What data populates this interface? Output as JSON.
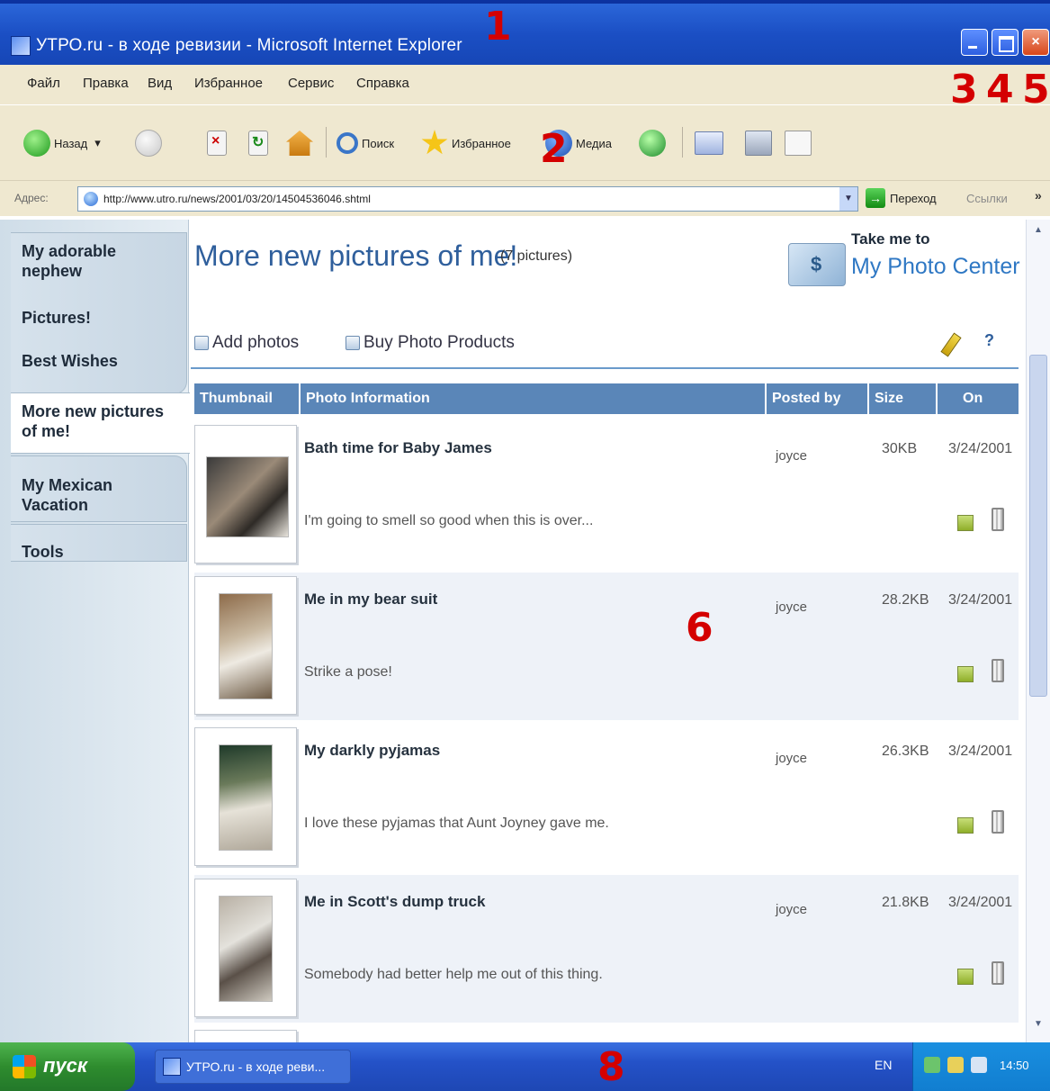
{
  "window": {
    "title": "УТРО.ru - в ходе ревизии - Microsoft Internet Explorer",
    "annotations": [
      "1",
      "2",
      "3",
      "4",
      "5",
      "6",
      "8"
    ]
  },
  "menu": [
    "Файл",
    "Правка",
    "Вид",
    "Избранное",
    "Сервис",
    "Справка"
  ],
  "toolbar": {
    "back_label": "Назад",
    "back_arrow": "▾",
    "search_label": "Поиск",
    "favorites_label": "Избранное",
    "media_label": "Медиа"
  },
  "address": {
    "label": "Адрес:",
    "url": "http://www.utro.ru/news/2001/03/20/14504536046.shtml",
    "go_label": "Переход",
    "links_label": "Ссылки",
    "links_arrow": "»"
  },
  "sidebar": {
    "items": [
      {
        "line1": "My adorable",
        "line2": "nephew"
      },
      {
        "line1": "Pictures!"
      },
      {
        "line1": "Best Wishes"
      },
      {
        "line1": "More new pictures",
        "line2": "of me!"
      },
      {
        "line1": "My Mexican",
        "line2": "Vacation"
      },
      {
        "line1": "Tools"
      }
    ]
  },
  "main": {
    "title": "More new pictures of me!",
    "count": "(7 pictures)",
    "photo_center": {
      "line1": "Take me to",
      "line2": "My Photo Center"
    },
    "actions": {
      "add": "Add photos",
      "buy": "Buy Photo Products",
      "help": "?"
    },
    "columns": [
      "Thumbnail",
      "Photo Information",
      "Posted by",
      "Size",
      "On"
    ],
    "rows": [
      {
        "title": "Bath time for Baby James",
        "desc": "I'm going to smell so good when this is over...",
        "by": "joyce",
        "size": "30KB",
        "date": "3/24/2001"
      },
      {
        "title": "Me in my bear suit",
        "desc": "Strike a pose!",
        "by": "joyce",
        "size": "28.2KB",
        "date": "3/24/2001"
      },
      {
        "title": "My darkly pyjamas",
        "desc": "I love these pyjamas that Aunt Joyney gave me.",
        "by": "joyce",
        "size": "26.3KB",
        "date": "3/24/2001"
      },
      {
        "title": "Me in Scott's dump truck",
        "desc": "Somebody had better help me out of this thing.",
        "by": "joyce",
        "size": "21.8KB",
        "date": "3/24/2001"
      }
    ]
  },
  "taskbar": {
    "start": "пуск",
    "task": "УТРО.ru - в ходе реви...",
    "lang": "EN",
    "clock": "14:50"
  },
  "colors": {
    "accent": "#2f5f9c",
    "header": "#5a86b8",
    "titlebar": "#1b4fc4",
    "annotation": "#d40000"
  }
}
